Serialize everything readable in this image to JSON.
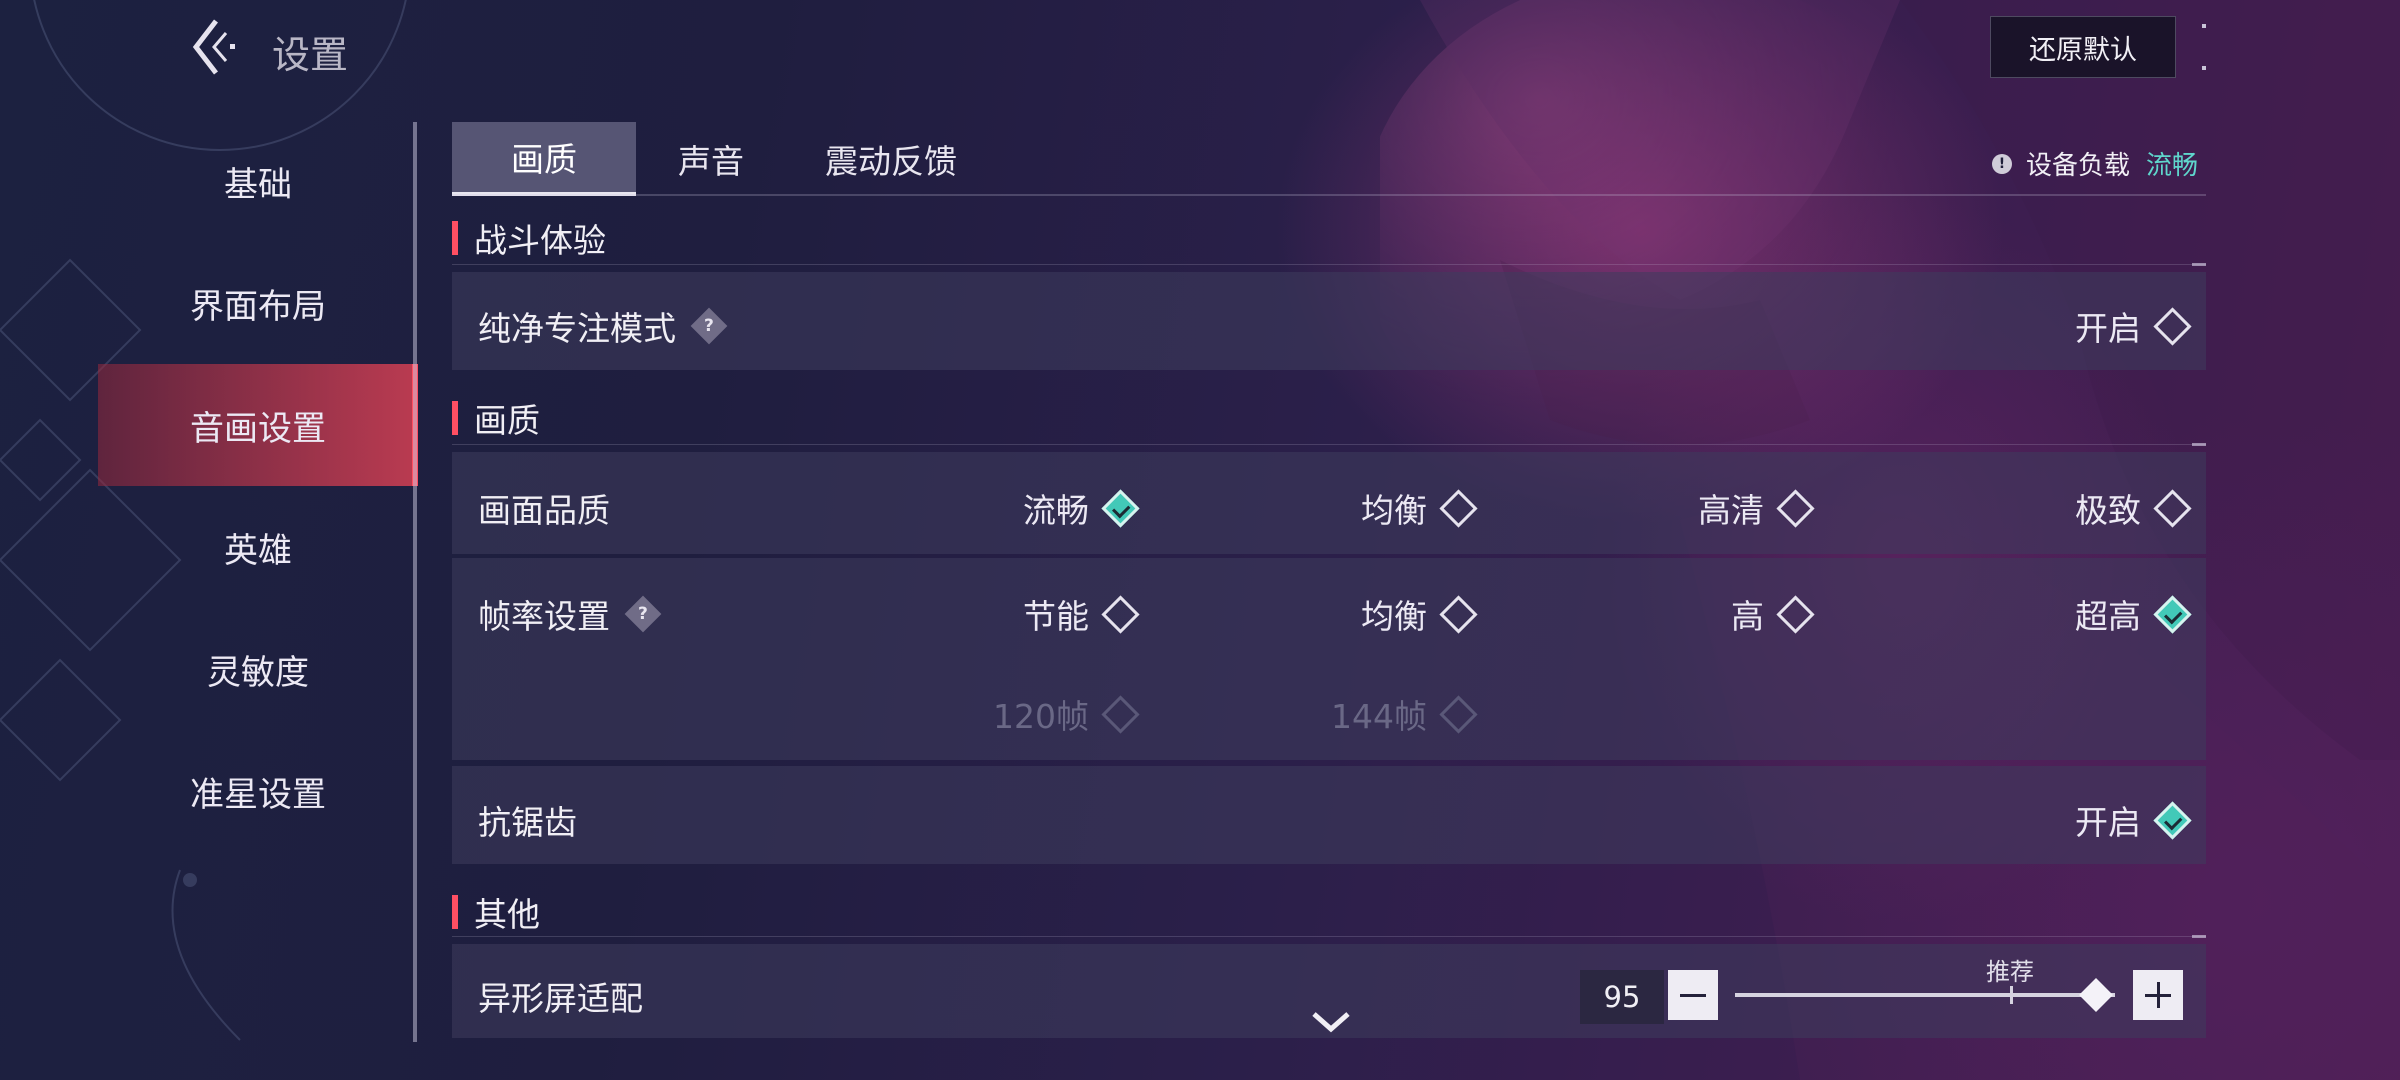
{
  "header": {
    "title": "设置",
    "reset_label": "还原默认",
    "device_load_label": "设备负载",
    "device_load_value": "流畅"
  },
  "sidebar": {
    "items": [
      {
        "label": "基础"
      },
      {
        "label": "界面布局"
      },
      {
        "label": "音画设置",
        "active": true
      },
      {
        "label": "英雄"
      },
      {
        "label": "灵敏度"
      },
      {
        "label": "准星设置"
      }
    ]
  },
  "tabs": [
    {
      "label": "画质",
      "active": true
    },
    {
      "label": "声音"
    },
    {
      "label": "震动反馈"
    }
  ],
  "sections": {
    "combat": {
      "title": "战斗体验",
      "pure_focus": {
        "label": "纯净专注模式",
        "option": "开启",
        "checked": false
      }
    },
    "quality": {
      "title": "画质",
      "picture_quality": {
        "label": "画面品质",
        "options": [
          {
            "label": "流畅",
            "checked": true
          },
          {
            "label": "均衡",
            "checked": false
          },
          {
            "label": "高清",
            "checked": false
          },
          {
            "label": "极致",
            "checked": false
          }
        ]
      },
      "frame_rate": {
        "label": "帧率设置",
        "options": [
          {
            "label": "节能",
            "checked": false
          },
          {
            "label": "均衡",
            "checked": false
          },
          {
            "label": "高",
            "checked": false
          },
          {
            "label": "超高",
            "checked": true
          }
        ],
        "extra_options": [
          {
            "label": "120帧",
            "disabled": true
          },
          {
            "label": "144帧",
            "disabled": true
          }
        ]
      },
      "anti_alias": {
        "label": "抗锯齿",
        "option": "开启",
        "checked": true
      }
    },
    "other": {
      "title": "其他",
      "screen_adapt": {
        "label": "异形屏适配",
        "value": "95",
        "recommend_label": "推荐",
        "level": 0.95
      }
    }
  },
  "icons": {
    "back": "back-arrow-icon",
    "help": "question-diamond-icon",
    "info": "exclamation-circle-icon",
    "more": "chevron-down-icon"
  },
  "colors": {
    "accent": "#ff4f63",
    "selected": "#42c9b8",
    "status_good": "#5fd6cc"
  }
}
